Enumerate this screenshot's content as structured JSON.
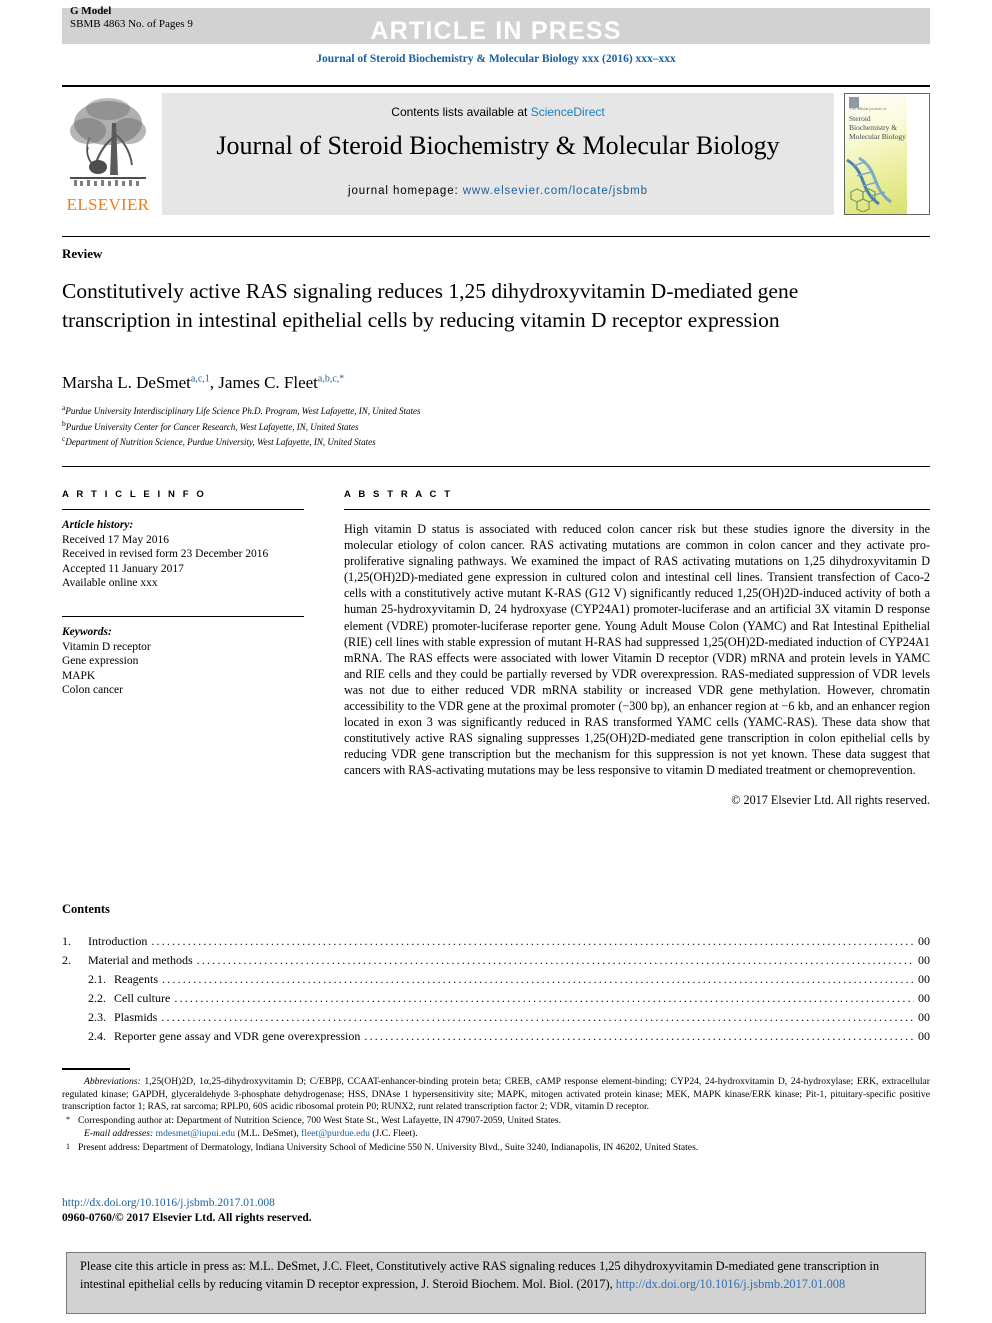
{
  "banner": {
    "press_label": "ARTICLE IN PRESS",
    "g_model": "G Model",
    "manuscript_id": "SBMB 4863 No. of Pages 9"
  },
  "running_head": "Journal of Steroid Biochemistry & Molecular Biology xxx (2016) xxx–xxx",
  "masthead": {
    "contents_prefix": "Contents lists available at ",
    "sciencedirect": "ScienceDirect",
    "journal_title": "Journal of Steroid Biochemistry & Molecular Biology",
    "homepage_prefix": "journal homepage: ",
    "homepage_url": "www.elsevier.com/locate/jsbmb",
    "publisher": "ELSEVIER",
    "cover_publisher_line": "The official journal of",
    "cover_title": "Steroid Biochemistry & Molecular Biology"
  },
  "article": {
    "kicker": "Review",
    "title": "Constitutively active RAS signaling reduces 1,25 dihydroxyvitamin D-mediated gene transcription in intestinal epithelial cells by reducing vitamin D receptor expression",
    "authors": [
      {
        "name": "Marsha L. DeSmet",
        "marks": "a,c,1"
      },
      {
        "name": "James C. Fleet",
        "marks": "a,b,c,*"
      }
    ],
    "affiliations": [
      {
        "mark": "a",
        "text": "Purdue University Interdisciplinary Life Science Ph.D. Program, West Lafayette, IN, United States"
      },
      {
        "mark": "b",
        "text": "Purdue University Center for Cancer Research, West Lafayette, IN, United States"
      },
      {
        "mark": "c",
        "text": "Department of Nutrition Science, Purdue University, West Lafayette, IN, United States"
      }
    ]
  },
  "info": {
    "heading": "A R T I C L E  I N F O",
    "history_label": "Article history:",
    "history": [
      "Received 17 May 2016",
      "Received in revised form 23 December 2016",
      "Accepted 11 January 2017",
      "Available online xxx"
    ],
    "keywords_label": "Keywords:",
    "keywords": [
      "Vitamin D receptor",
      "Gene expression",
      "MAPK",
      "Colon cancer"
    ]
  },
  "abstract": {
    "heading": "A B S T R A C T",
    "text": "High vitamin D status is associated with reduced colon cancer risk but these studies ignore the diversity in the molecular etiology of colon cancer. RAS activating mutations are common in colon cancer and they activate pro-proliferative signaling pathways. We examined the impact of RAS activating mutations on 1,25 dihydroxyvitamin D (1,25(OH)2D)-mediated gene expression in cultured colon and intestinal cell lines. Transient transfection of Caco-2 cells with a constitutively active mutant K-RAS (G12 V) significantly reduced 1,25(OH)2D-induced activity of both a human 25-hydroxyvitamin D, 24 hydroxyase (CYP24A1) promoter-luciferase and an artificial 3X vitamin D response element (VDRE) promoter-luciferase reporter gene. Young Adult Mouse Colon (YAMC) and Rat Intestinal Epithelial (RIE) cell lines with stable expression of mutant H-RAS had suppressed 1,25(OH)2D-mediated induction of CYP24A1 mRNA. The RAS effects were associated with lower Vitamin D receptor (VDR) mRNA and protein levels in YAMC and RIE cells and they could be partially reversed by VDR overexpression. RAS-mediated suppression of VDR levels was not due to either reduced VDR mRNA stability or increased VDR gene methylation. However, chromatin accessibility to the VDR gene at the proximal promoter (−300 bp), an enhancer region at −6 kb, and an enhancer region located in exon 3 was significantly reduced in RAS transformed YAMC cells (YAMC-RAS). These data show that constitutively active RAS signaling suppresses 1,25(OH)2D-mediated gene transcription in colon epithelial cells by reducing VDR gene transcription but the mechanism for this suppression is not yet known. These data suggest that cancers with RAS-activating mutations may be less responsive to vitamin D mediated treatment or chemoprevention.",
    "copyright": "© 2017 Elsevier Ltd. All rights reserved."
  },
  "contents": {
    "heading": "Contents",
    "items": [
      {
        "num": "1.",
        "label": "Introduction",
        "page": "00",
        "level": 1
      },
      {
        "num": "2.",
        "label": "Material and methods",
        "page": "00",
        "level": 1
      },
      {
        "num": "2.1.",
        "label": "Reagents",
        "page": "00",
        "level": 2
      },
      {
        "num": "2.2.",
        "label": "Cell culture",
        "page": "00",
        "level": 2
      },
      {
        "num": "2.3.",
        "label": "Plasmids",
        "page": "00",
        "level": 2
      },
      {
        "num": "2.4.",
        "label": "Reporter gene assay and VDR gene overexpression",
        "page": "00",
        "level": 2
      }
    ]
  },
  "footnotes": {
    "abbreviations_label": "Abbreviations:",
    "abbreviations_text": "1,25(OH)2D, 1α,25-dihydroxyvitamin D; C/EBPβ, CCAAT-enhancer-binding protein beta; CREB, cAMP response element-binding; CYP24, 24-hydroxvitamin D, 24-hydroxylase; ERK, extracellular regulated kinase; GAPDH, glyceraldehyde 3-phosphate dehydrogenase; HSS, DNAse 1 hypersensitivity site; MAPK, mitogen activated protein kinase; MEK, MAPK kinase/ERK kinase; Pit-1, pituitary-specific positive transcription factor 1; RAS, rat sarcoma; RPLP0, 60S acidic ribosomal protein P0; RUNX2, runt related transcription factor 2; VDR, vitamin D receptor.",
    "corresponding_mark": "*",
    "corresponding_text": "Corresponding author at: Department of Nutrition Science, 700 West State St., West Lafayette, IN 47907-2059, United States.",
    "email_label": "E-mail addresses:",
    "emails": [
      {
        "address": "mdesmet@iupui.edu",
        "owner": "(M.L. DeSmet)"
      },
      {
        "address": "fleet@purdue.edu",
        "owner": "(J.C. Fleet)"
      }
    ],
    "present_mark": "1",
    "present_text": "Present address: Department of Dermatology, Indiana University School of Medicine 550 N. University Blvd., Suite 3240, Indianapolis, IN 46202, United States."
  },
  "doi": {
    "url": "http://dx.doi.org/10.1016/j.jsbmb.2017.01.008",
    "issn_line": "0960-0760/© 2017 Elsevier Ltd. All rights reserved."
  },
  "citation": {
    "text_part1": "Please cite this article in press as: M.L. DeSmet, J.C. Fleet, Constitutively active RAS signaling reduces 1,25 dihydroxyvitamin D-mediated gene transcription in intestinal epithelial cells by reducing vitamin D receptor expression, J. Steroid Biochem. Mol. Biol. (2017), ",
    "link": "http://dx.doi.org/10.1016/j.jsbmb.2017.01.008"
  },
  "colors": {
    "link_blue": "#1a5f9e",
    "elsevier_orange": "#ef7d1a",
    "banner_gray": "#d2d2d2",
    "masthead_gray": "#e6e6e6"
  }
}
